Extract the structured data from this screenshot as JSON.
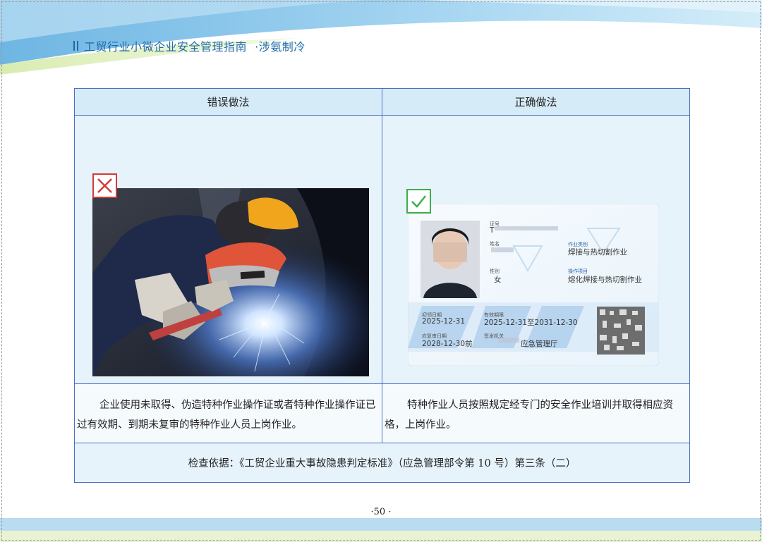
{
  "header": {
    "title": "工贸行业小微企业安全管理指南",
    "subtitle": "·涉氨制冷"
  },
  "table": {
    "wrong_header": "错误做法",
    "right_header": "正确做法",
    "wrong_description": "企业使用未取得、伪造特种作业操作证或者特种作业操作证已过有效期、到期未复审的特种作业人员上岗作业。",
    "right_description": "特种作业人员按照规定经专门的安全作业培训并取得相应资格，上岗作业。",
    "basis": "检查依据：《工贸企业重大事故隐患判定标准》（应急管理部令第 10 号）第三条（二）"
  },
  "certificate": {
    "id_label": "证号",
    "id_value": "T",
    "name_label": "姓名",
    "gender_label": "性别",
    "gender_value": "女",
    "category_label": "作业类别",
    "category_value": "焊接与热切割作业",
    "item_label": "操作项目",
    "item_value": "熔化焊接与热切割作业",
    "first_issue_label": "初领日期",
    "first_issue_value": "2025-12-31",
    "validity_label": "有效期限",
    "validity_value": "2025-12-31至2031-12-30",
    "review_label": "应复审日期",
    "review_value": "2028-12-30前",
    "issuer_label": "签发机关",
    "issuer_value": "应急管理厅"
  },
  "page_number": "·50 ·",
  "colors": {
    "header_text": "#1e6aa8",
    "table_border": "#4a6fbf",
    "wrong_mark": "#d23a3a",
    "right_mark": "#3cae4a"
  },
  "icons": {
    "wrong": "cross-mark-icon",
    "right": "check-mark-icon"
  }
}
